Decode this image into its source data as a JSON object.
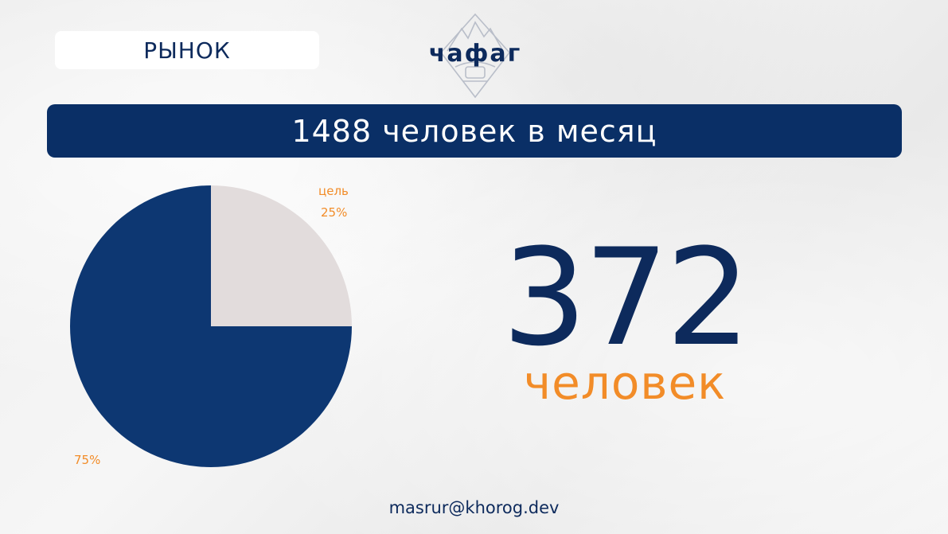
{
  "header": {
    "section_label": "РЫНОК",
    "logo_text": "чафаг"
  },
  "banner": {
    "text": "1488 человек в месяц"
  },
  "highlight": {
    "number": "372",
    "unit": "человек"
  },
  "footer": {
    "email": "masrur@khorog.dev"
  },
  "colors": {
    "navy": "#0a2f66",
    "navy_text": "#0d2a5c",
    "slice_light": "#e2dcdc",
    "orange": "#f28c28"
  },
  "chart_data": {
    "type": "pie",
    "slices": [
      {
        "label": "цель",
        "value": 25,
        "display": "25%",
        "color": "#e2dcdc"
      },
      {
        "label": "",
        "value": 75,
        "display": "75%",
        "color": "#0d3772"
      }
    ]
  }
}
